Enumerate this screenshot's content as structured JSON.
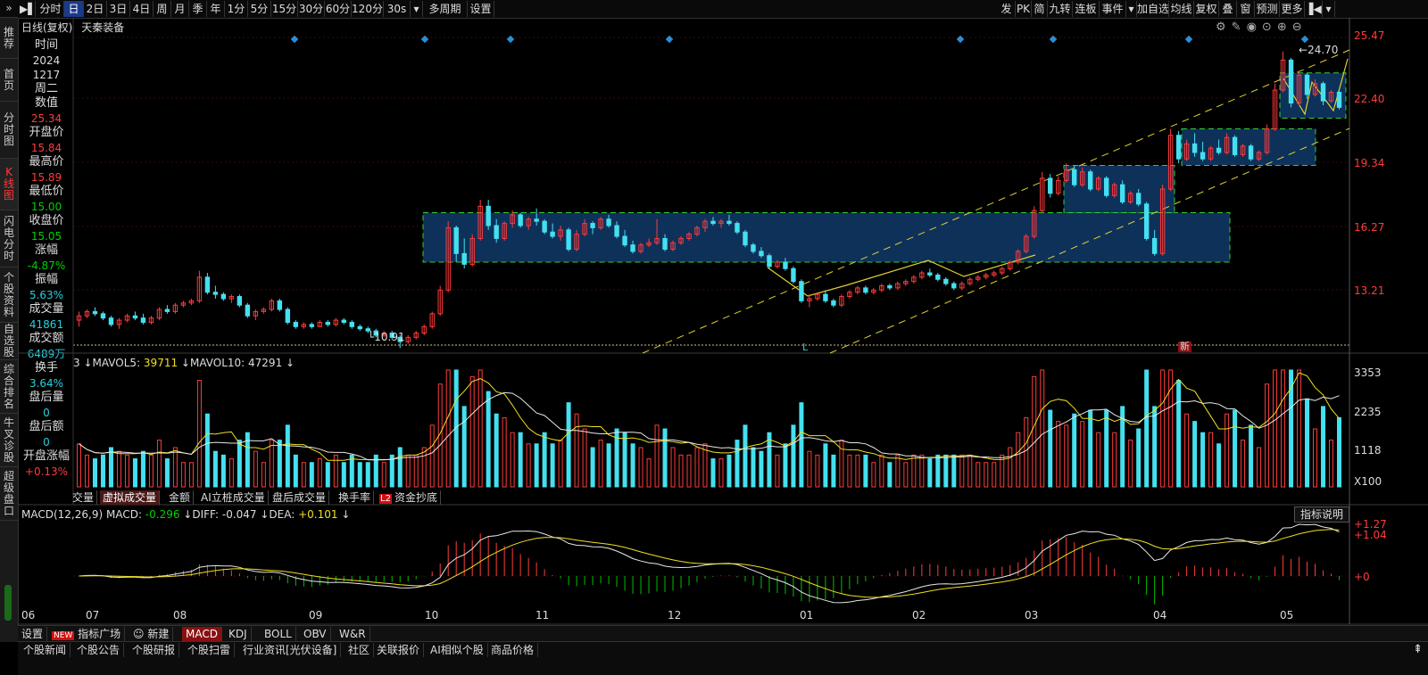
{
  "toolbar": {
    "left_items": [
      {
        "label": "分时",
        "active": false
      },
      {
        "label": "日",
        "active": true
      },
      {
        "label": "2日",
        "active": false
      },
      {
        "label": "3日",
        "active": false
      },
      {
        "label": "4日",
        "active": false
      },
      {
        "label": "周",
        "active": false
      },
      {
        "label": "月",
        "active": false
      },
      {
        "label": "季",
        "active": false
      },
      {
        "label": "年",
        "active": false
      },
      {
        "label": "1分",
        "active": false
      },
      {
        "label": "5分",
        "active": false
      },
      {
        "label": "15分",
        "active": false
      },
      {
        "label": "30分",
        "active": false
      },
      {
        "label": "60分",
        "active": false
      },
      {
        "label": "120分",
        "active": false
      },
      {
        "label": "30s",
        "active": false
      },
      {
        "label": "多周期",
        "active": false
      },
      {
        "label": "设置",
        "active": false
      }
    ],
    "right_items": [
      "发",
      "PK",
      "简",
      "九转",
      "连板",
      "事件",
      "加自选",
      "均线",
      "复权",
      "叠",
      "窗",
      "预测",
      "更多"
    ]
  },
  "left_nav": [
    "推荐",
    "首页",
    "分时图",
    "K线图",
    "闪电分时",
    "个股资料",
    "自选股",
    "综合排名",
    "牛叉诊股",
    "超级盘口"
  ],
  "left_nav_active": "K线图",
  "chart_header": {
    "mode": "日线(复权)",
    "stock": "天秦装备"
  },
  "info_panel": [
    {
      "label": "时间",
      "value": "2024",
      "value2": "1217",
      "value3": "周二",
      "color": "wht"
    },
    {
      "label": "数值",
      "value": "25.34",
      "color": "red"
    },
    {
      "label": "开盘价",
      "value": "15.84",
      "color": "red"
    },
    {
      "label": "最高价",
      "value": "15.89",
      "color": "red"
    },
    {
      "label": "最低价",
      "value": "15.00",
      "color": "grn"
    },
    {
      "label": "收盘价",
      "value": "15.05",
      "color": "grn"
    },
    {
      "label": "涨幅",
      "value": "-4.87%",
      "color": "grn"
    },
    {
      "label": "振幅",
      "value": "5.63%",
      "color": "cyn"
    },
    {
      "label": "成交量",
      "value": "41861",
      "color": "cyn"
    },
    {
      "label": "成交额",
      "value": "6489万",
      "color": "cyn"
    },
    {
      "label": "换手",
      "value": "3.64%",
      "color": "cyn"
    },
    {
      "label": "盘后量",
      "value": "0",
      "color": "cyn"
    },
    {
      "label": "盘后额",
      "value": "0",
      "color": "cyn"
    },
    {
      "label": "开盘涨幅",
      "value": "+0.13%",
      "color": "red"
    }
  ],
  "price_axis": [
    "25.47",
    "22.40",
    "19.34",
    "16.27",
    "13.21"
  ],
  "annotations": {
    "high": "24.70",
    "low": "10.91",
    "marker_l": "L",
    "marker_new": "新"
  },
  "volume": {
    "legend": "量 ↓MAVOL5: 39711 ↓MAVOL10: 47291 ↓",
    "legend_parts": {
      "mavol5": "39711",
      "mavol10": "47291"
    },
    "axis": [
      "3353",
      "2235",
      "1118",
      "X100"
    ]
  },
  "vol_tabs": [
    "交量",
    "虚拟成交量",
    "金额",
    "AI立桩成交量",
    "盘后成交量",
    "换手率",
    "资金抄底"
  ],
  "vol_tab_active": "虚拟成交量",
  "vol_tab_badge": "L2",
  "macd": {
    "legend_title": "MACD(12,26,9)",
    "macd": "-0.296",
    "diff": "-0.047",
    "dea": "+0.101",
    "axis": [
      "+1.27",
      "+1.04",
      "+0"
    ],
    "explain_button": "指标说明"
  },
  "months": [
    "06",
    "07",
    "08",
    "09",
    "10",
    "11",
    "12",
    "01",
    "02",
    "03",
    "04",
    "05"
  ],
  "indicator_bar": {
    "settings": "设置",
    "new_badge": "NEW",
    "plaza": "指标广场",
    "new_item": "新建",
    "items": [
      "MACD",
      "KDJ",
      "BOLL",
      "OBV",
      "W&R"
    ],
    "active": "MACD"
  },
  "news_bar": [
    "个股新闻",
    "个股公告",
    "个股研报",
    "个股扫雷",
    "行业资讯[光伏设备]",
    "社区",
    "关联报价",
    "AI相似个股",
    "商品价格"
  ],
  "colors": {
    "up": "#ff3b3b",
    "down": "#44e0f0",
    "ma_white": "#e8e8e8",
    "ma_yellow": "#f0e020",
    "box": "#103a6a",
    "box_border": "#30d030"
  },
  "chart_data": {
    "type": "candlestick",
    "price_range": [
      11.0,
      25.6
    ],
    "candles": [
      [
        12.2,
        12.6,
        11.9,
        12.4
      ],
      [
        12.4,
        12.7,
        12.3,
        12.6
      ],
      [
        12.6,
        12.8,
        12.4,
        12.5
      ],
      [
        12.5,
        12.6,
        12.2,
        12.3
      ],
      [
        12.3,
        12.4,
        11.9,
        12.0
      ],
      [
        12.0,
        12.3,
        11.8,
        12.2
      ],
      [
        12.2,
        12.5,
        12.1,
        12.4
      ],
      [
        12.4,
        12.6,
        12.2,
        12.3
      ],
      [
        12.3,
        12.5,
        12.0,
        12.1
      ],
      [
        12.1,
        12.4,
        12.0,
        12.3
      ],
      [
        12.3,
        12.8,
        12.2,
        12.7
      ],
      [
        12.7,
        12.9,
        12.5,
        12.6
      ],
      [
        12.6,
        13.0,
        12.5,
        12.9
      ],
      [
        12.9,
        13.1,
        12.8,
        13.0
      ],
      [
        13.0,
        13.2,
        12.9,
        13.1
      ],
      [
        13.1,
        14.5,
        13.0,
        14.2
      ],
      [
        14.2,
        14.4,
        13.4,
        13.5
      ],
      [
        13.5,
        13.8,
        13.2,
        13.4
      ],
      [
        13.4,
        13.5,
        13.1,
        13.2
      ],
      [
        13.2,
        13.4,
        13.0,
        13.3
      ],
      [
        13.3,
        13.4,
        12.8,
        12.9
      ],
      [
        12.9,
        13.0,
        12.3,
        12.4
      ],
      [
        12.4,
        12.7,
        12.2,
        12.6
      ],
      [
        12.6,
        12.8,
        12.5,
        12.7
      ],
      [
        12.7,
        13.2,
        12.6,
        13.1
      ],
      [
        13.1,
        13.2,
        12.6,
        12.7
      ],
      [
        12.7,
        12.8,
        12.0,
        12.1
      ],
      [
        12.1,
        12.2,
        11.8,
        11.9
      ],
      [
        11.9,
        12.1,
        11.8,
        12.0
      ],
      [
        12.0,
        12.1,
        11.8,
        11.9
      ],
      [
        11.9,
        12.2,
        11.9,
        12.1
      ],
      [
        12.1,
        12.2,
        11.9,
        12.0
      ],
      [
        12.0,
        12.3,
        11.9,
        12.2
      ],
      [
        12.2,
        12.3,
        12.0,
        12.1
      ],
      [
        12.1,
        12.2,
        11.8,
        11.9
      ],
      [
        11.9,
        12.0,
        11.7,
        11.8
      ],
      [
        11.8,
        11.9,
        11.6,
        11.7
      ],
      [
        11.7,
        11.8,
        11.4,
        11.5
      ],
      [
        11.5,
        11.7,
        11.4,
        11.6
      ],
      [
        11.6,
        11.7,
        11.3,
        11.4
      ],
      [
        11.4,
        11.5,
        10.9,
        11.2
      ],
      [
        11.2,
        11.5,
        11.1,
        11.4
      ],
      [
        11.4,
        11.7,
        11.3,
        11.6
      ],
      [
        11.6,
        12.0,
        11.5,
        11.9
      ],
      [
        11.9,
        12.6,
        11.8,
        12.5
      ],
      [
        12.5,
        13.8,
        12.4,
        13.6
      ],
      [
        13.6,
        16.8,
        13.5,
        16.5
      ],
      [
        16.5,
        16.6,
        14.9,
        15.3
      ],
      [
        15.3,
        16.0,
        14.6,
        14.8
      ],
      [
        14.8,
        16.2,
        14.7,
        16.0
      ],
      [
        16.0,
        17.8,
        15.9,
        17.5
      ],
      [
        17.5,
        17.8,
        16.4,
        16.6
      ],
      [
        16.6,
        16.9,
        15.8,
        16.0
      ],
      [
        16.0,
        16.8,
        15.9,
        16.7
      ],
      [
        16.7,
        17.3,
        16.5,
        17.1
      ],
      [
        17.1,
        17.2,
        16.5,
        16.6
      ],
      [
        16.6,
        17.0,
        16.4,
        16.9
      ],
      [
        16.9,
        17.4,
        16.6,
        16.8
      ],
      [
        16.8,
        16.9,
        16.2,
        16.3
      ],
      [
        16.3,
        16.7,
        16.0,
        16.1
      ],
      [
        16.1,
        16.6,
        15.9,
        16.4
      ],
      [
        16.4,
        16.5,
        15.4,
        15.5
      ],
      [
        15.5,
        16.4,
        15.4,
        16.2
      ],
      [
        16.2,
        16.9,
        16.1,
        16.7
      ],
      [
        16.7,
        16.8,
        16.2,
        16.5
      ],
      [
        16.5,
        17.0,
        16.4,
        16.9
      ],
      [
        16.9,
        17.1,
        16.5,
        16.6
      ],
      [
        16.6,
        16.8,
        16.0,
        16.1
      ],
      [
        16.1,
        16.4,
        15.6,
        15.7
      ],
      [
        15.7,
        15.9,
        15.3,
        15.4
      ],
      [
        15.4,
        15.8,
        15.3,
        15.7
      ],
      [
        15.7,
        16.0,
        15.6,
        15.8
      ],
      [
        15.8,
        16.9,
        15.7,
        16.0
      ],
      [
        16.0,
        16.2,
        15.4,
        15.5
      ],
      [
        15.5,
        15.9,
        15.4,
        15.8
      ],
      [
        15.8,
        16.1,
        15.7,
        16.0
      ],
      [
        16.0,
        16.3,
        15.9,
        16.2
      ],
      [
        16.2,
        16.6,
        16.1,
        16.5
      ],
      [
        16.5,
        16.9,
        16.3,
        16.8
      ],
      [
        16.8,
        17.0,
        16.6,
        16.7
      ],
      [
        16.7,
        16.9,
        16.5,
        16.8
      ],
      [
        16.8,
        17.1,
        16.6,
        16.7
      ],
      [
        16.7,
        16.8,
        16.2,
        16.3
      ],
      [
        16.3,
        16.4,
        15.6,
        15.7
      ],
      [
        15.7,
        15.8,
        15.3,
        15.4
      ],
      [
        15.4,
        15.6,
        15.1,
        15.2
      ],
      [
        15.2,
        15.3,
        14.6,
        14.7
      ],
      [
        14.7,
        15.0,
        14.6,
        14.9
      ],
      [
        14.9,
        15.1,
        14.5,
        14.6
      ],
      [
        14.6,
        14.7,
        13.9,
        14.0
      ],
      [
        14.0,
        14.1,
        13.0,
        13.1
      ],
      [
        13.1,
        13.4,
        12.8,
        13.2
      ],
      [
        13.2,
        13.5,
        13.1,
        13.4
      ],
      [
        13.4,
        13.6,
        13.0,
        13.1
      ],
      [
        13.1,
        13.2,
        12.8,
        12.9
      ],
      [
        12.9,
        13.4,
        12.8,
        13.3
      ],
      [
        13.3,
        13.6,
        13.2,
        13.5
      ],
      [
        13.5,
        13.8,
        13.4,
        13.7
      ],
      [
        13.7,
        13.8,
        13.4,
        13.5
      ],
      [
        13.5,
        13.7,
        13.4,
        13.6
      ],
      [
        13.6,
        13.9,
        13.5,
        13.8
      ],
      [
        13.8,
        13.9,
        13.6,
        13.7
      ],
      [
        13.7,
        14.0,
        13.6,
        13.9
      ],
      [
        13.9,
        14.1,
        13.8,
        14.0
      ],
      [
        14.0,
        14.3,
        13.9,
        14.2
      ],
      [
        14.2,
        14.5,
        14.1,
        14.4
      ],
      [
        14.4,
        14.6,
        14.2,
        14.3
      ],
      [
        14.3,
        14.4,
        14.0,
        14.1
      ],
      [
        14.1,
        14.2,
        13.8,
        13.9
      ],
      [
        13.9,
        14.0,
        13.6,
        13.7
      ],
      [
        13.7,
        14.0,
        13.6,
        13.9
      ],
      [
        13.9,
        14.2,
        13.8,
        14.1
      ],
      [
        14.1,
        14.3,
        14.0,
        14.2
      ],
      [
        14.2,
        14.4,
        14.1,
        14.3
      ],
      [
        14.3,
        14.5,
        14.2,
        14.4
      ],
      [
        14.4,
        14.7,
        14.3,
        14.6
      ],
      [
        14.6,
        15.0,
        14.5,
        14.9
      ],
      [
        14.9,
        15.5,
        14.8,
        15.4
      ],
      [
        15.4,
        16.2,
        15.3,
        16.1
      ],
      [
        16.1,
        17.5,
        16.0,
        17.3
      ],
      [
        17.3,
        19.1,
        17.2,
        18.8
      ],
      [
        18.8,
        19.0,
        17.9,
        18.1
      ],
      [
        18.1,
        18.9,
        18.0,
        18.7
      ],
      [
        18.7,
        19.5,
        18.6,
        19.2
      ],
      [
        19.2,
        19.4,
        18.4,
        18.5
      ],
      [
        18.5,
        19.3,
        18.4,
        19.1
      ],
      [
        19.1,
        19.2,
        18.2,
        18.3
      ],
      [
        18.3,
        18.9,
        18.2,
        18.8
      ],
      [
        18.8,
        18.9,
        17.9,
        18.0
      ],
      [
        18.0,
        18.6,
        17.9,
        18.5
      ],
      [
        18.5,
        18.7,
        17.6,
        17.7
      ],
      [
        17.7,
        18.2,
        17.6,
        18.1
      ],
      [
        18.1,
        18.3,
        17.5,
        17.6
      ],
      [
        17.6,
        17.7,
        15.9,
        16.0
      ],
      [
        16.0,
        16.4,
        15.2,
        15.3
      ],
      [
        15.3,
        18.5,
        15.2,
        18.3
      ],
      [
        18.3,
        21.1,
        18.2,
        20.8
      ],
      [
        20.8,
        21.0,
        19.5,
        19.7
      ],
      [
        19.7,
        20.6,
        19.6,
        20.4
      ],
      [
        20.4,
        20.9,
        19.8,
        20.0
      ],
      [
        20.0,
        20.5,
        19.6,
        19.7
      ],
      [
        19.7,
        20.3,
        19.6,
        20.2
      ],
      [
        20.2,
        20.6,
        19.9,
        20.0
      ],
      [
        20.0,
        20.9,
        19.9,
        20.7
      ],
      [
        20.7,
        20.8,
        19.8,
        19.9
      ],
      [
        19.9,
        20.4,
        19.8,
        20.3
      ],
      [
        20.3,
        20.4,
        19.6,
        19.7
      ],
      [
        19.7,
        20.1,
        19.6,
        20.0
      ],
      [
        20.0,
        21.3,
        19.9,
        21.1
      ],
      [
        21.1,
        23.2,
        21.0,
        22.9
      ],
      [
        22.9,
        24.7,
        22.8,
        24.3
      ],
      [
        24.3,
        24.4,
        22.1,
        22.3
      ],
      [
        22.3,
        23.8,
        22.2,
        23.6
      ],
      [
        23.6,
        23.7,
        22.5,
        22.7
      ],
      [
        22.7,
        23.4,
        22.6,
        23.2
      ],
      [
        23.2,
        23.3,
        22.2,
        22.4
      ],
      [
        22.4,
        22.9,
        22.3,
        22.8
      ],
      [
        22.8,
        22.9,
        22.0,
        22.1
      ]
    ]
  }
}
